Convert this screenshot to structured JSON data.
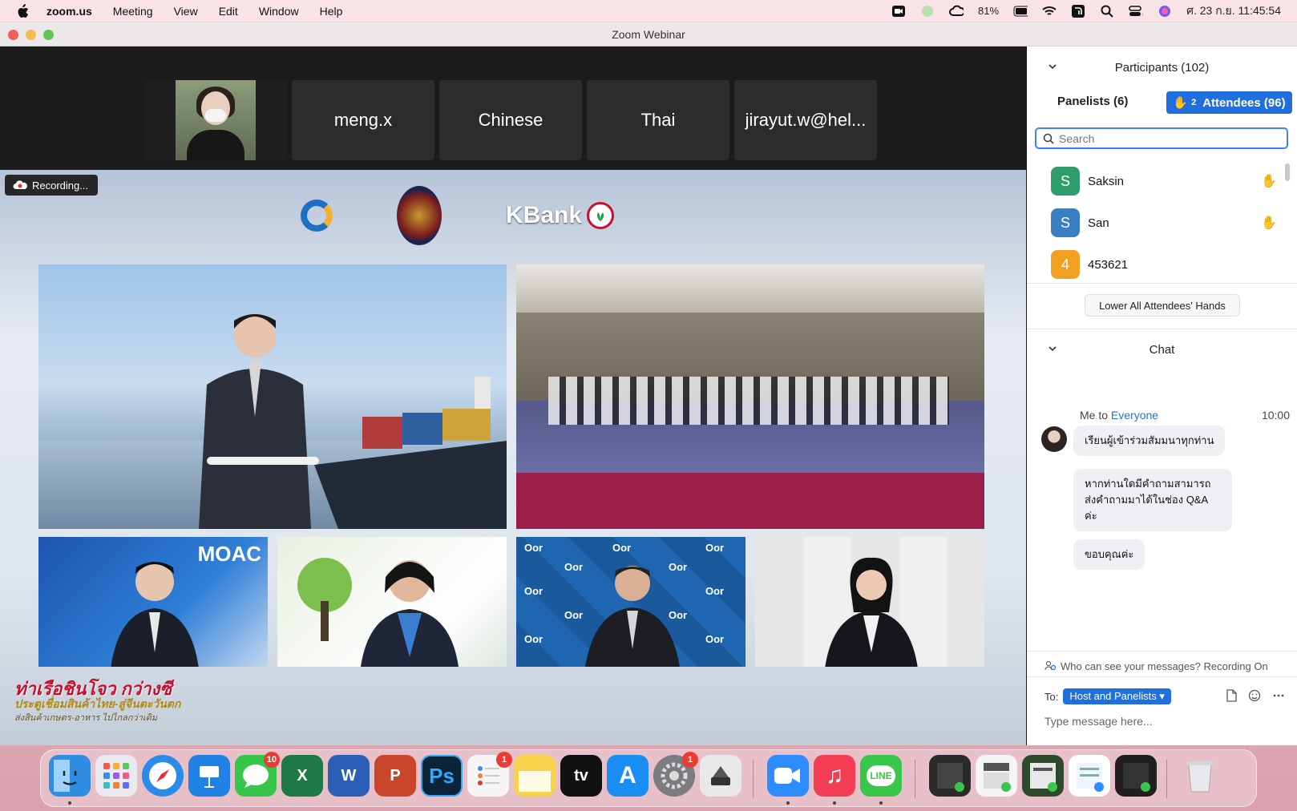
{
  "menubar": {
    "app": "zoom.us",
    "items": [
      "Meeting",
      "View",
      "Edit",
      "Window",
      "Help"
    ],
    "battery": "81%",
    "datetime": "ศ. 23 ก.ย.  11:45:54"
  },
  "window": {
    "title": "Zoom Webinar"
  },
  "stage": {
    "tiles": [
      "meng.x",
      "Chinese",
      "Thai",
      "jirayut.w@hel..."
    ],
    "recording_label": "Recording...",
    "slide": {
      "kbank_logo": "KBank",
      "moac_logo": "MOAC",
      "oor_logo": "Oor",
      "banner_line1": "ท่าเรือชินโจว กว่างซี",
      "banner_line2": "ประตูเชื่อมสินค้าไทย-สู่จีนตะวันตก",
      "banner_line3": "ส่งสินค้าเกษตร-อาหาร ไปไกลกว่าเดิม"
    }
  },
  "participants": {
    "title": "Participants (102)",
    "tab_panelists": "Panelists (6)",
    "tab_attendees": "Attendees (96)",
    "raised_hands_count": "2",
    "search_placeholder": "Search",
    "list": [
      {
        "initial": "S",
        "name": "Saksin",
        "color": "#2e9e6e",
        "hand": true
      },
      {
        "initial": "S",
        "name": "San",
        "color": "#3a7fc1",
        "hand": true
      },
      {
        "initial": "4",
        "name": "453621",
        "color": "#f2a022",
        "hand": false
      }
    ],
    "lower_hands_label": "Lower All Attendees' Hands"
  },
  "chat": {
    "title": "Chat",
    "meta_prefix": "Me to ",
    "meta_to": "Everyone",
    "time": "10:00",
    "messages": [
      "เรียนผู้เข้าร่วมสัมมนาทุกท่าน",
      "หากท่านใดมีคำถามสามารถส่งคำถามมาได้ในช่อง Q&A ค่ะ",
      "ขอบคุณค่ะ"
    ],
    "visibility_note": "Who can see your messages? Recording On",
    "to_label": "To:",
    "to_target": "Host and Panelists",
    "input_placeholder": "Type message here..."
  },
  "dock": {
    "apps": [
      {
        "name": "finder",
        "label": "",
        "color": "#2f8ce3"
      },
      {
        "name": "launchpad",
        "label": "",
        "color": "#e9e9ef"
      },
      {
        "name": "safari",
        "label": "",
        "color": "#2a8be8"
      },
      {
        "name": "keynote",
        "label": "",
        "color": "#1f82e4"
      },
      {
        "name": "messages",
        "label": "",
        "color": "#36c64b",
        "badge": "10"
      },
      {
        "name": "excel",
        "label": "X",
        "color": "#1e7a45"
      },
      {
        "name": "word",
        "label": "W",
        "color": "#2b5fb5"
      },
      {
        "name": "powerpoint",
        "label": "P",
        "color": "#c9462a"
      },
      {
        "name": "photoshop",
        "label": "Ps",
        "color": "#0b2438"
      },
      {
        "name": "reminders",
        "label": "",
        "color": "#f5f5f5",
        "badge": "1"
      },
      {
        "name": "notes",
        "label": "",
        "color": "#f6d34a"
      },
      {
        "name": "appletv",
        "label": "tv",
        "color": "#111111"
      },
      {
        "name": "appstore",
        "label": "A",
        "color": "#1a8ff3"
      },
      {
        "name": "settings",
        "label": "",
        "color": "#7b7b80",
        "badge": "1"
      },
      {
        "name": "scanner",
        "label": "",
        "color": "#e8e8e8"
      },
      {
        "name": "zoom",
        "label": "",
        "color": "#2d8cff"
      },
      {
        "name": "music",
        "label": "♫",
        "color": "#f23d55"
      },
      {
        "name": "line",
        "label": "LINE",
        "color": "#39c64b"
      }
    ]
  }
}
